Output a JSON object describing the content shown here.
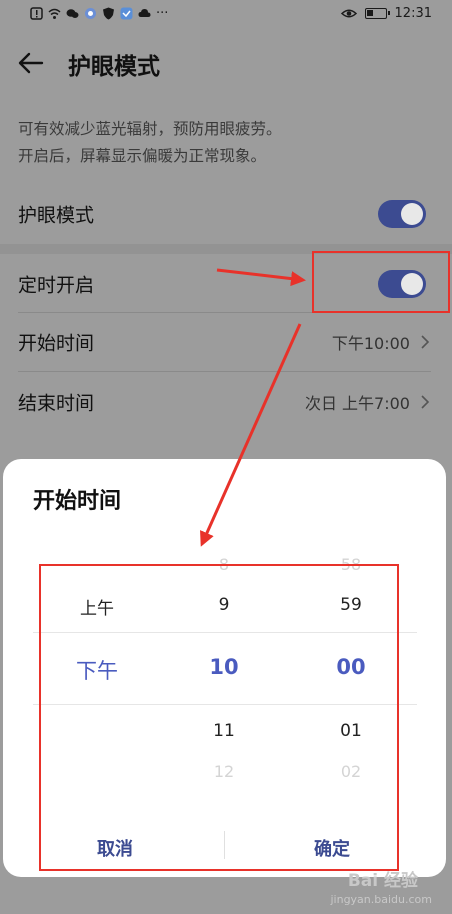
{
  "status_bar": {
    "time": "12:31",
    "more": "···"
  },
  "header": {
    "title": "护眼模式",
    "back_icon": "arrow-left-icon"
  },
  "description": {
    "line1": "可有效减少蓝光辐射，预防用眼疲劳。",
    "line2": "开启后，屏幕显示偏暖为正常现象。"
  },
  "settings": {
    "eye_comfort": {
      "label": "护眼模式",
      "enabled": true
    },
    "scheduled": {
      "label": "定时开启",
      "enabled": true
    },
    "start_time": {
      "label": "开始时间",
      "value": "下午10:00"
    },
    "end_time": {
      "label": "结束时间",
      "value": "次日 上午7:00"
    }
  },
  "dialog": {
    "title": "开始时间",
    "ampm": {
      "above": "上午",
      "selected": "下午"
    },
    "hours": {
      "above2": "8",
      "above1": "9",
      "selected": "10",
      "below1": "11",
      "below2": "12"
    },
    "minutes": {
      "above2": "58",
      "above1": "59",
      "selected": "00",
      "below1": "01",
      "below2": "02"
    },
    "cancel_label": "取消",
    "confirm_label": "确定"
  },
  "colors": {
    "accent": "#3c4b91",
    "picker_selected": "#4a5bbf",
    "annotation": "#e8322a"
  },
  "watermark": {
    "text": "Bai 经验",
    "sub": "jingyan.baidu.com"
  }
}
